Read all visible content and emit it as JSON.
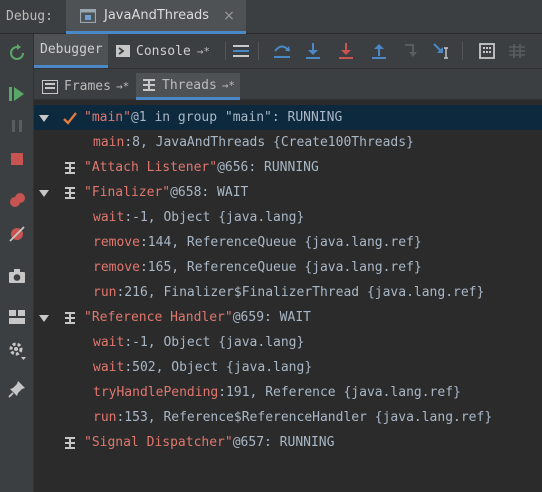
{
  "header": {
    "debug_label": "Debug:",
    "tab_title": "JavaAndThreads",
    "tab_close": "×"
  },
  "toolbar": {
    "debugger_label": "Debugger",
    "console_label": "Console",
    "console_suffix": "→*"
  },
  "subbar": {
    "frames_label": "Frames",
    "threads_label": "Threads",
    "suffix": "→*"
  },
  "threads": [
    {
      "name": "\"main\"",
      "info": "@1 in group \"main\": RUNNING",
      "icon": "checkmark-icon",
      "expanded": true,
      "selected": true,
      "frames": [
        {
          "method": "main",
          "rest": ":8, JavaAndThreads {Create100Threads}",
          "highlight": false
        }
      ]
    },
    {
      "name": "\"Attach Listener\"",
      "info": "@656: RUNNING",
      "icon": "thread-icon",
      "expanded": false,
      "frames": []
    },
    {
      "name": "\"Finalizer\"",
      "info": "@658: WAIT",
      "icon": "thread-icon",
      "expanded": true,
      "frames": [
        {
          "method": "wait",
          "rest": ":-1, Object {java.lang}"
        },
        {
          "method": "remove",
          "rest": ":144, ReferenceQueue {java.lang.ref}"
        },
        {
          "method": "remove",
          "rest": ":165, ReferenceQueue {java.lang.ref}"
        },
        {
          "method": "run",
          "rest": ":216, Finalizer$FinalizerThread {java.lang.ref}"
        }
      ]
    },
    {
      "name": "\"Reference Handler\"",
      "info": "@659: WAIT",
      "icon": "thread-icon",
      "expanded": true,
      "frames": [
        {
          "method": "wait",
          "rest": ":-1, Object {java.lang}"
        },
        {
          "method": "wait",
          "rest": ":502, Object {java.lang}"
        },
        {
          "method": "tryHandlePending",
          "rest": ":191, Reference {java.lang.ref}"
        },
        {
          "method": "run",
          "rest": ":153, Reference$ReferenceHandler {java.lang.ref}"
        }
      ]
    },
    {
      "name": "\"Signal Dispatcher\"",
      "info": "@657: RUNNING",
      "icon": "thread-icon",
      "expanded": false,
      "frames": []
    }
  ],
  "colors": {
    "accent": "#4a88c7",
    "thread_name": "#e0776e",
    "text": "#a9b7c6",
    "selection": "#0d293e"
  }
}
